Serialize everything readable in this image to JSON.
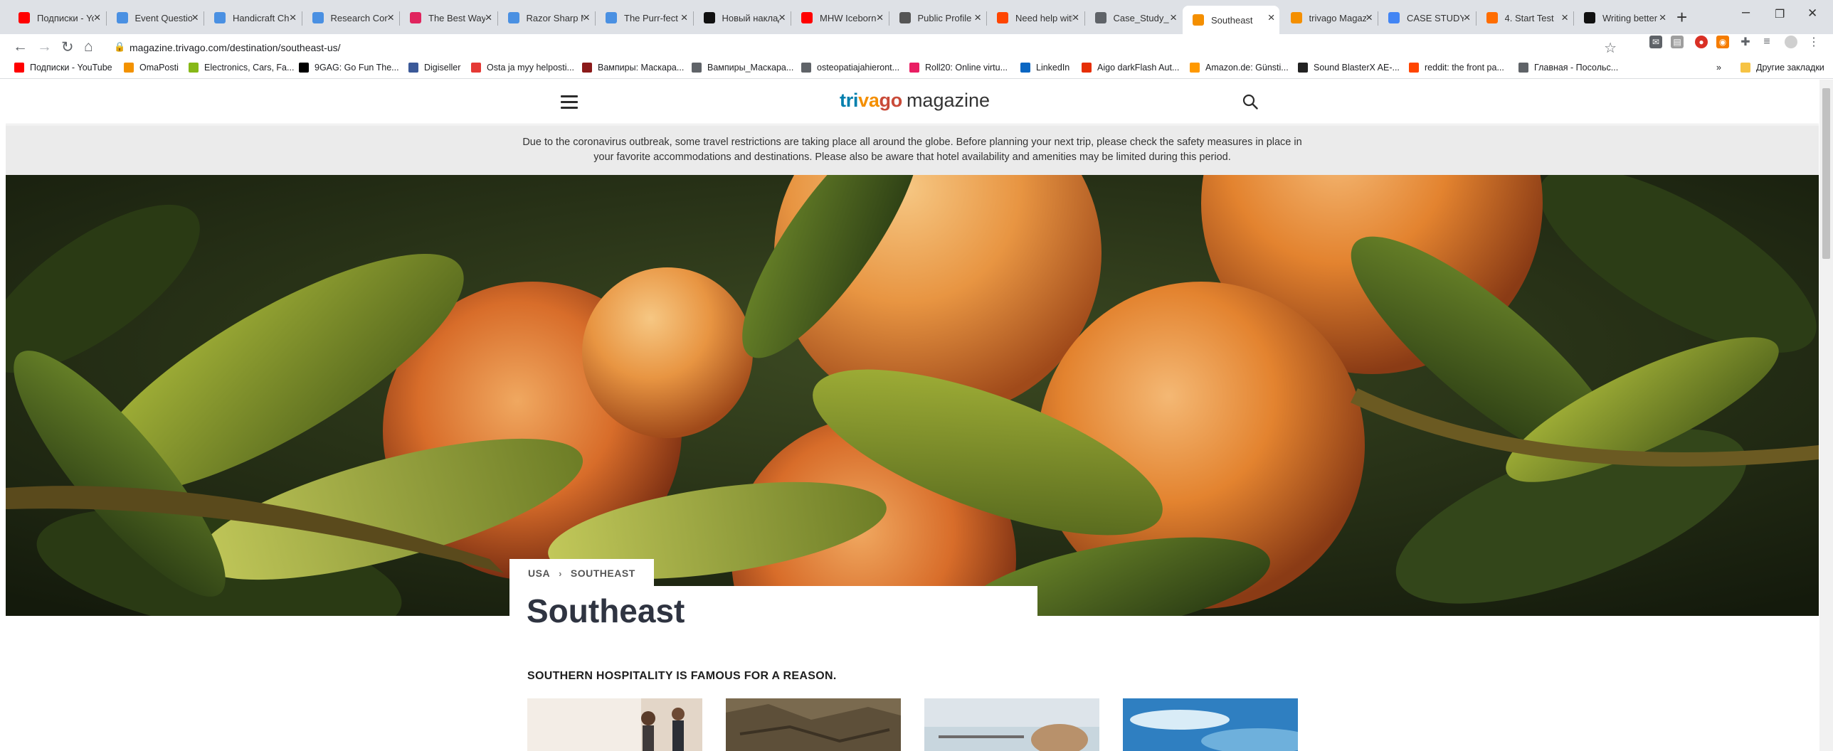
{
  "browser": {
    "tabs": [
      {
        "title": "Подписки - YouTube",
        "icon": "youtube-icon",
        "color": "#ff0000"
      },
      {
        "title": "Event Questions",
        "icon": "trophy-icon",
        "color": "#4a90e2"
      },
      {
        "title": "Handicraft Challenge",
        "icon": "trophy-icon",
        "color": "#4a90e2"
      },
      {
        "title": "Research Contest",
        "icon": "trophy-icon",
        "color": "#4a90e2"
      },
      {
        "title": "The Best Ways",
        "icon": "bookmark-icon",
        "color": "#e0245e"
      },
      {
        "title": "Razor Sharp Minds",
        "icon": "trophy-icon",
        "color": "#4a90e2"
      },
      {
        "title": "The Purr-fect",
        "icon": "trophy-icon",
        "color": "#4a90e2"
      },
      {
        "title": "Новый наклад",
        "icon": "k-icon",
        "color": "#111111"
      },
      {
        "title": "MHW Iceborne",
        "icon": "youtube-icon",
        "color": "#ff0000"
      },
      {
        "title": "Public Profile",
        "icon": "chat-icon",
        "color": "#555555"
      },
      {
        "title": "Need help with",
        "icon": "reddit-icon",
        "color": "#ff4500"
      },
      {
        "title": "Case_Study_",
        "icon": "globe-icon",
        "color": "#5f6368"
      },
      {
        "title": "Southeast",
        "icon": "trivago-icon",
        "color": "#f48f00",
        "active": true
      },
      {
        "title": "trivago Magazine",
        "icon": "trivago-icon",
        "color": "#f48f00"
      },
      {
        "title": "CASE STUDY",
        "icon": "docs-icon",
        "color": "#4285f4"
      },
      {
        "title": "4. Start Test",
        "icon": "test-icon",
        "color": "#ff6d00"
      },
      {
        "title": "Writing better",
        "icon": "medium-icon",
        "color": "#111111"
      }
    ],
    "new_tab_symbol": "+",
    "window_controls": {
      "minimize": "–",
      "restore": "❐",
      "close": "✕"
    },
    "nav": {
      "back": "←",
      "forward": "→",
      "reload": "↻",
      "home": "⌂"
    },
    "address": {
      "url": "magazine.trivago.com/destination/southeast-us/"
    },
    "bookmarks": [
      {
        "label": "Подписки - YouTube",
        "icon": "youtube-icon",
        "color": "#ff0000"
      },
      {
        "label": "OmaPosti",
        "icon": "posti-icon",
        "color": "#f39200"
      },
      {
        "label": "Electronics, Cars, Fa...",
        "icon": "ebay-icon",
        "color": "#86b817"
      },
      {
        "label": "9GAG: Go Fun The...",
        "icon": "9gag-icon",
        "color": "#000000"
      },
      {
        "label": "Digiseller",
        "icon": "bag-icon",
        "color": "#3b5998"
      },
      {
        "label": "Osta ja myy helposti...",
        "icon": "tori-icon",
        "color": "#e53935"
      },
      {
        "label": "Вампиры: Маскара...",
        "icon": "steam-icon",
        "color": "#8b1a1a"
      },
      {
        "label": "Вампиры_Маскара...",
        "icon": "globe-icon",
        "color": "#5f6368"
      },
      {
        "label": "osteopatiajahieront...",
        "icon": "globe-icon",
        "color": "#5f6368"
      },
      {
        "label": "Roll20: Online virtu...",
        "icon": "roll20-icon",
        "color": "#e91e63"
      },
      {
        "label": "LinkedIn",
        "icon": "linkedin-icon",
        "color": "#0a66c2"
      },
      {
        "label": "Aigo darkFlash Aut...",
        "icon": "aliexpress-icon",
        "color": "#e62e04"
      },
      {
        "label": "Amazon.de: Günsti...",
        "icon": "amazon-icon",
        "color": "#ff9900"
      },
      {
        "label": "Sound BlasterX AE-...",
        "icon": "delta-icon",
        "color": "#222222"
      },
      {
        "label": "reddit: the front pa...",
        "icon": "reddit-icon",
        "color": "#ff4500"
      },
      {
        "label": "Главная - Посольс...",
        "icon": "globe-icon",
        "color": "#5f6368"
      }
    ],
    "bookmarks_overflow": "»",
    "other_bookmarks": "Другие закладки"
  },
  "site": {
    "logo_part1": "trivago",
    "logo_part2": "magazine",
    "notice": "Due to the coronavirus outbreak, some travel restrictions are taking place all around the globe. Before planning your next trip, please check the safety measures in place in your favorite accommodations and destinations. Please also be aware that hotel availability and amenities may be limited during this period.",
    "breadcrumb": [
      "USA",
      "SOUTHEAST"
    ],
    "breadcrumb_sep": "›",
    "title": "Southeast",
    "subheading": "SOUTHERN HOSPITALITY IS FAMOUS FOR A REASON.",
    "colors": {
      "logo_tri": "#007fad",
      "logo_va": "#f48f00",
      "logo_go": "#c94a38",
      "title": "#2f3441"
    }
  }
}
